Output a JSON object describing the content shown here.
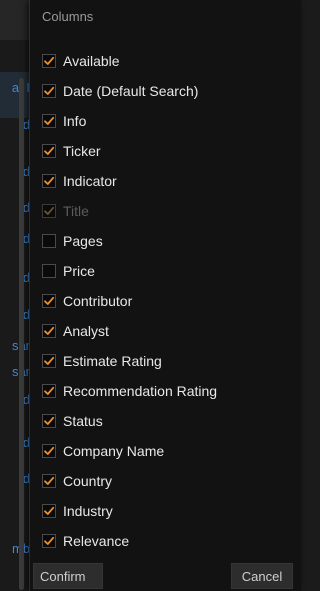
{
  "background_list": {
    "items": [
      "a, I",
      "d",
      "d",
      "d",
      "d",
      "d",
      "d",
      "sar",
      "sar",
      "d",
      "d",
      "d",
      "mb"
    ]
  },
  "popup": {
    "title": "Columns",
    "options": [
      {
        "label": "Available",
        "checked": true,
        "disabled": false
      },
      {
        "label": "Date (Default Search)",
        "checked": true,
        "disabled": false
      },
      {
        "label": "Info",
        "checked": true,
        "disabled": false
      },
      {
        "label": "Ticker",
        "checked": true,
        "disabled": false
      },
      {
        "label": "Indicator",
        "checked": true,
        "disabled": false
      },
      {
        "label": "Title",
        "checked": true,
        "disabled": true
      },
      {
        "label": "Pages",
        "checked": false,
        "disabled": false
      },
      {
        "label": "Price",
        "checked": false,
        "disabled": false
      },
      {
        "label": "Contributor",
        "checked": true,
        "disabled": false
      },
      {
        "label": "Analyst",
        "checked": true,
        "disabled": false
      },
      {
        "label": "Estimate Rating",
        "checked": true,
        "disabled": false
      },
      {
        "label": "Recommendation Rating",
        "checked": true,
        "disabled": false
      },
      {
        "label": "Status",
        "checked": true,
        "disabled": false
      },
      {
        "label": "Company Name",
        "checked": true,
        "disabled": false
      },
      {
        "label": "Country",
        "checked": true,
        "disabled": false
      },
      {
        "label": "Industry",
        "checked": true,
        "disabled": false
      },
      {
        "label": "Relevance",
        "checked": true,
        "disabled": false
      }
    ],
    "confirm_label": "Confirm",
    "cancel_label": "Cancel"
  },
  "colors": {
    "checkmark": "#f0902a",
    "checkmark_disabled": "#6a5230",
    "link": "#3f88d3"
  }
}
